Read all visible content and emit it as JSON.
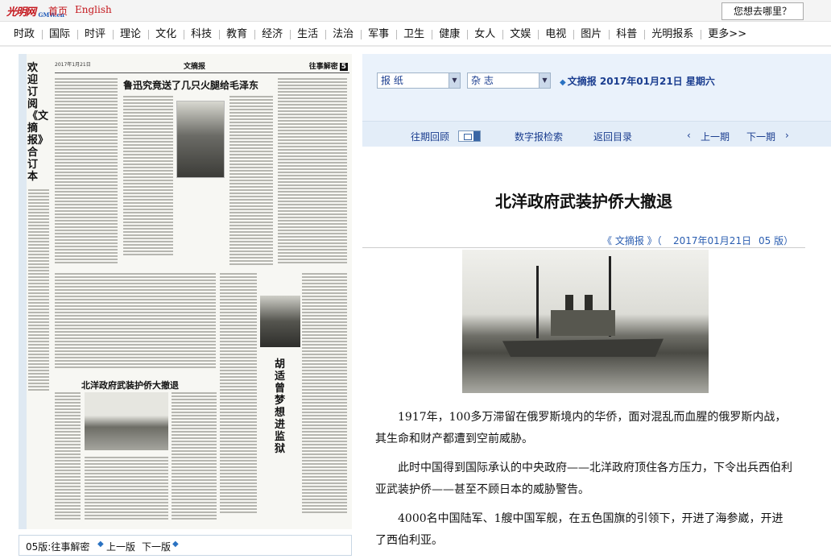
{
  "header": {
    "logo_text": "光明网",
    "logo_sub": "GMW.cn",
    "home_label": "首页",
    "english_label": "English",
    "search_button": "您想去哪里？"
  },
  "nav": [
    "时政",
    "国际",
    "时评",
    "理论",
    "文化",
    "科技",
    "教育",
    "经济",
    "生活",
    "法治",
    "军事",
    "卫生",
    "健康",
    "女人",
    "文娱",
    "电视",
    "图片",
    "科普",
    "光明报系",
    "更多>>"
  ],
  "newspaper": {
    "promo": "欢迎订阅《文摘报》合订本",
    "date_line": "2017年1月21日",
    "masthead": "文摘报",
    "section": "往事解密",
    "page_no": "5",
    "headline1": "鲁迅究竟送了几只火腿给毛泽东",
    "headline2": "北洋政府武装护侨大撤退",
    "headline3": "胡适曾梦想进监狱"
  },
  "paper_footer": {
    "edition": "05版:往事解密",
    "prev": "上一版",
    "next": "下一版"
  },
  "selectors": {
    "paper": "报  纸",
    "magazine": "杂  志",
    "issue": "文摘报 2017年01月21日 星期六"
  },
  "toolbar": {
    "archive": "往期回顾",
    "search": "数字报检索",
    "back": "返回目录",
    "prev_issue": "上一期",
    "next_issue": "下一期"
  },
  "article": {
    "title": "北洋政府武装护侨大撤退",
    "source": "《 文摘报 》（",
    "date": "2017年01月21日",
    "edition": "05 版）",
    "paragraphs": [
      "1917年，100多万滞留在俄罗斯境内的华侨，面对混乱而血腥的俄罗斯内战，其生命和财产都遭到空前威胁。",
      "此时中国得到国际承认的中央政府——北洋政府顶住各方压力，下令出兵西伯利亚武装护侨——甚至不顾日本的威胁警告。",
      "4000名中国陆军、1艘中国军舰，在五色国旗的引领下，开进了海参崴，开进了西伯利亚。"
    ]
  }
}
